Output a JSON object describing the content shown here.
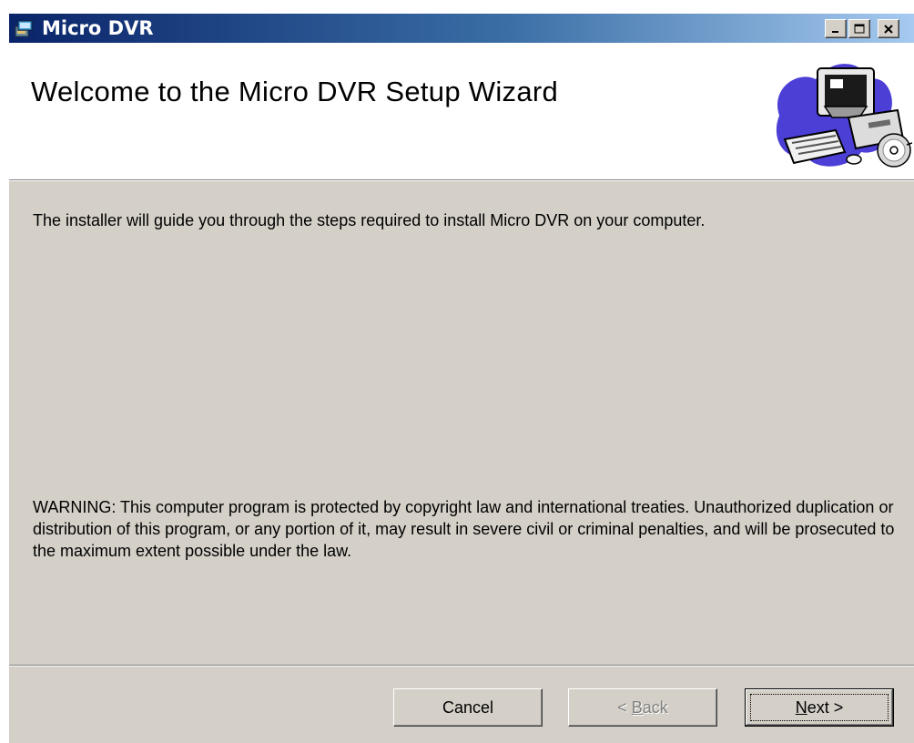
{
  "window": {
    "title": "Micro DVR",
    "controls": {
      "minimize": "minimize",
      "maximize": "maximize",
      "close": "close"
    }
  },
  "header": {
    "heading": "Welcome to the Micro DVR Setup Wizard",
    "art_icon": "computer-cd-icon"
  },
  "body": {
    "intro": "The installer will guide you through the steps required to install Micro DVR on your computer.",
    "warning": "WARNING: This computer program is protected by copyright law and international treaties. Unauthorized duplication or distribution of this program, or any portion of it, may result in severe civil or criminal penalties, and will be prosecuted to the maximum extent possible under the law."
  },
  "buttons": {
    "cancel": "Cancel",
    "back_prefix": "< ",
    "back_accel": "B",
    "back_rest": "ack",
    "next_accel": "N",
    "next_rest": "ext >"
  },
  "colors": {
    "titlebar_start": "#0a246a",
    "titlebar_end": "#a6caf0",
    "dialog_face": "#d4d0c8",
    "header_bg": "#ffffff"
  }
}
